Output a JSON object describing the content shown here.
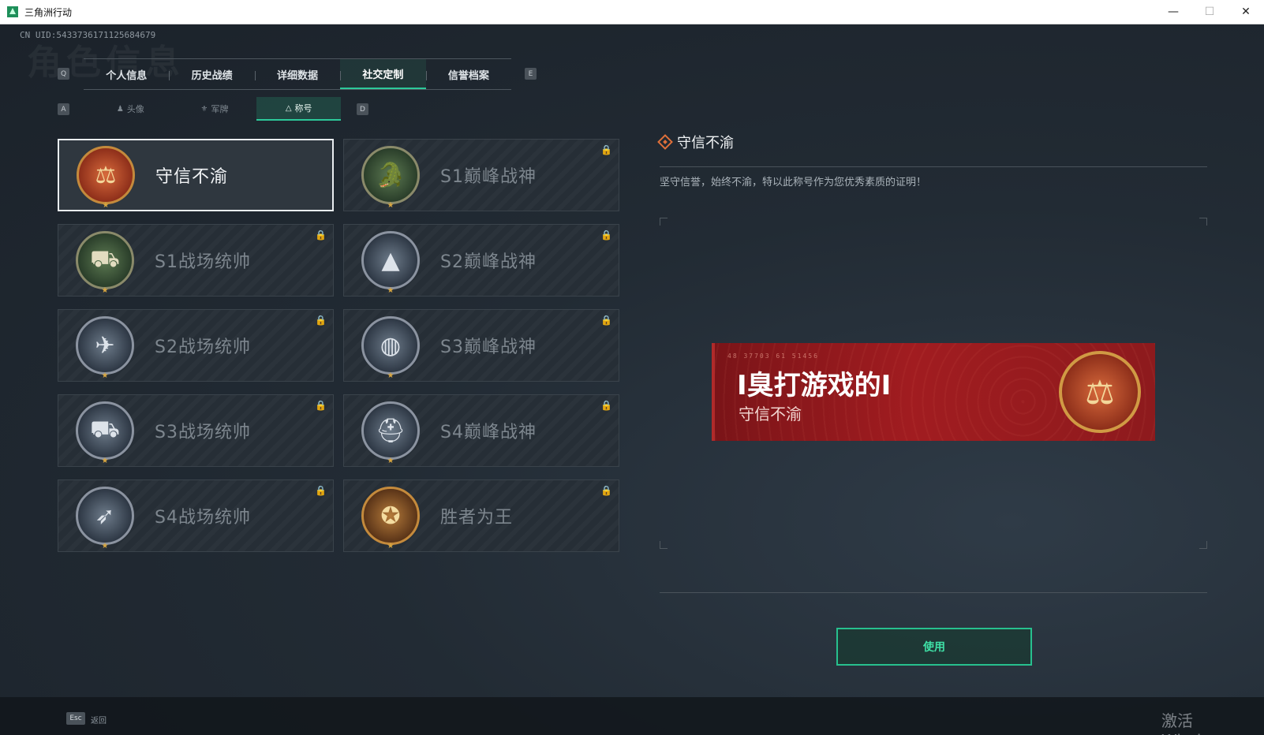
{
  "window": {
    "title": "三角洲行动",
    "minimize": "—",
    "maximize": "☐",
    "close": "✕"
  },
  "header": {
    "watermark": "角色信息",
    "uid": "CN UID:5433736171125684679"
  },
  "tabs": {
    "prev_key": "Q",
    "next_key": "E",
    "items": [
      {
        "label": "个人信息"
      },
      {
        "label": "历史战绩"
      },
      {
        "label": "详细数据"
      },
      {
        "label": "社交定制",
        "active": true
      },
      {
        "label": "信誉档案"
      }
    ]
  },
  "subtabs": {
    "prev_key": "A",
    "next_key": "D",
    "items": [
      {
        "label": "头像",
        "icon": "person-icon"
      },
      {
        "label": "军牌",
        "icon": "badge-icon"
      },
      {
        "label": "称号",
        "icon": "triangle-icon",
        "active": true
      }
    ]
  },
  "titles": [
    {
      "name": "守信不渝",
      "medal": "scales",
      "color": "red",
      "locked": false,
      "selected": true
    },
    {
      "name": "S1巅峰战神",
      "medal": "crocodile",
      "color": "green",
      "locked": true
    },
    {
      "name": "S1战场统帅",
      "medal": "tank",
      "color": "green",
      "locked": true
    },
    {
      "name": "S2巅峰战神",
      "medal": "pyramid",
      "color": "steel",
      "locked": true
    },
    {
      "name": "S2战场统帅",
      "medal": "helicopter",
      "color": "steel",
      "locked": true
    },
    {
      "name": "S3巅峰战神",
      "medal": "globe",
      "color": "steel",
      "locked": true
    },
    {
      "name": "S3战场统帅",
      "medal": "armored-vehicle",
      "color": "steel",
      "locked": true
    },
    {
      "name": "S4巅峰战神",
      "medal": "helmet",
      "color": "steel",
      "locked": true
    },
    {
      "name": "S4战场统帅",
      "medal": "missile",
      "color": "steel",
      "locked": true
    },
    {
      "name": "胜者为王",
      "medal": "medal-star",
      "color": "bronze",
      "locked": true
    }
  ],
  "detail": {
    "title": "守信不渝",
    "description": "坚守信誉，始终不渝，特以此称号作为您优秀素质的证明！"
  },
  "banner": {
    "code": "48 37703  61 51456",
    "player_name": "I臭打游戏的I",
    "title": "守信不渝"
  },
  "use_button": "使用",
  "footer": {
    "esc_key": "Esc",
    "back_label": "返回"
  },
  "os_watermark": "激活 Windows",
  "colors": {
    "accent": "#2cc99a",
    "banner": "#a11c20",
    "medal_gold": "#d09a44"
  }
}
